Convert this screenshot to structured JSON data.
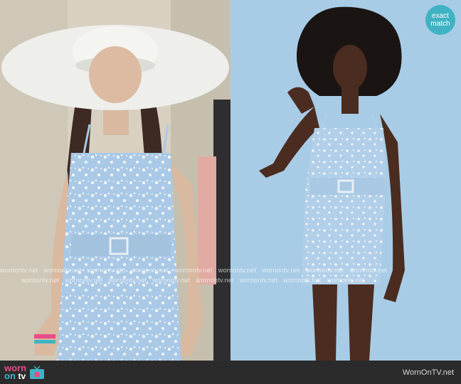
{
  "badge": {
    "line1": "exact",
    "line2": "match"
  },
  "watermark": {
    "text": "wornontv.net"
  },
  "footer": {
    "brand_worn": "worn",
    "brand_on": "on",
    "brand_tv": "tv",
    "site": "WornOnTV.net"
  },
  "colors": {
    "badge": "#3fb3c3",
    "footer_bg": "#2b2b2b",
    "brand_pink": "#e84c8a",
    "dress_blue": "#a9c9e6",
    "backdrop_blue": "#a8cce6"
  },
  "icons": [
    "tv-icon"
  ]
}
